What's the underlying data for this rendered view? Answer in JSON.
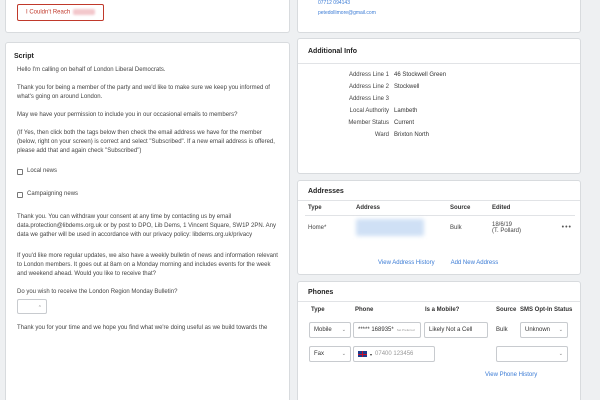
{
  "top": {
    "couldnt_reach_label": "I Couldn't Reach",
    "contact_phone": "07712 094143",
    "contact_email": "petedollimore@gmail.com"
  },
  "script": {
    "title": "Script",
    "p1": "Hello I'm calling on behalf of London Liberal Democrats.",
    "p2": "Thank you for being a member of the party and we'd like to make sure we keep you informed of what's going on around London.",
    "p3": "May we have your permission to include you in our occasional emails to members?",
    "p4": "(If Yes, then click both the tags below then check the email address we have for the member (below, right on your screen) is correct and select \"Subscribed\". If a new email address is offered, please add that and again check \"Subscribed\")",
    "checkbox_local": "Local news",
    "checkbox_campaigning": "Campaigning news",
    "p5": "Thank you. You can withdraw your consent at any time by contacting us by email data.protection@libdems.org.uk or by post to DPO, Lib Dems, 1 Vincent Square, SW1P 2PN. Any data we gather will be used in accordance with our privacy policy: libdems.org.uk/privacy",
    "p6": "If you'd like more regular updates, we also have a weekly bulletin of news and information relevant to London members. It goes out at 8am on a Monday morning and includes events for the week and weekend ahead. Would you like to receive that?",
    "p7": "Do you wish to receive the London Region Monday Bulletin?",
    "p8": "Thank you for your time and we hope you find what we're doing useful as we build towards the"
  },
  "additional_info": {
    "title": "Additional Info",
    "rows": [
      {
        "key": "Address Line 1",
        "value": "46 Stockwell Green"
      },
      {
        "key": "Address Line 2",
        "value": "Stockwell"
      },
      {
        "key": "Address Line 3",
        "value": ""
      },
      {
        "key": "Local Authority",
        "value": "Lambeth"
      },
      {
        "key": "Member Status",
        "value": "Current"
      },
      {
        "key": "Ward",
        "value": "Brixton North"
      }
    ]
  },
  "addresses": {
    "title": "Addresses",
    "headers": [
      "Type",
      "Address",
      "Source",
      "Edited"
    ],
    "row": {
      "type": "Home*",
      "source": "Bulk",
      "edited_date": "18/6/19",
      "edited_by": "(T. Pollard)",
      "menu": "•••"
    },
    "view_history": "View Address History",
    "add_new": "Add New Address"
  },
  "phones": {
    "title": "Phones",
    "headers": [
      "Type",
      "Phone",
      "Is a Mobile?",
      "Source",
      "SMS Opt-In Status"
    ],
    "row1": {
      "type": "Mobile",
      "phone": "***** 168935*",
      "phone_note": "Set Preferred",
      "mobile": "Likely Not a Cell",
      "source": "Bulk",
      "sms": "Unknown"
    },
    "row2": {
      "type": "Fax",
      "placeholder": "07400 123456"
    },
    "view_history": "View Phone History"
  }
}
